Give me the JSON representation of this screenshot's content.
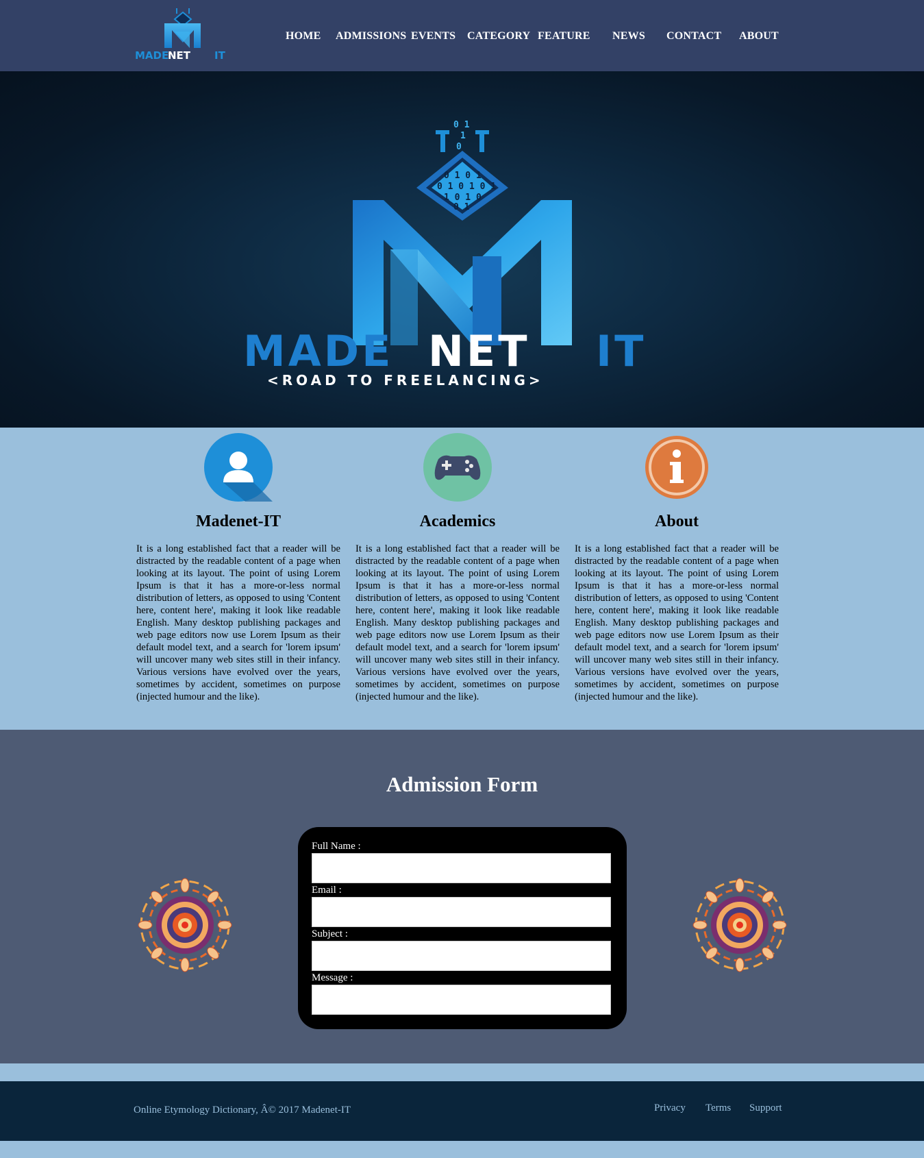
{
  "brand": {
    "logo_text": "MADENET IT",
    "logo_text_part1": "MADE",
    "logo_text_part2": "NET",
    "logo_text_part3": "IT",
    "tagline": "<ROAD TO FREELANCING>",
    "colors": {
      "nav_bg": "#334166",
      "accent_blue": "#1e8fd8",
      "light_blue": "#9abfdc"
    }
  },
  "nav": {
    "items": [
      {
        "label": "HOME"
      },
      {
        "label": "ADMISSIONS"
      },
      {
        "label": "EVENTS"
      },
      {
        "label": "CATEGORY"
      },
      {
        "label": "FEATURE"
      },
      {
        "label": "NEWS"
      },
      {
        "label": "CONTACT"
      },
      {
        "label": "ABOUT"
      }
    ]
  },
  "hero": {
    "logo_main": "MADENET IT",
    "logo_tagline": "<ROAD TO FREELANCING>",
    "binary_rows": [
      "0 1",
      "1",
      "0",
      "0 1 0 1",
      "0 1 0 1 0 1",
      "1 0 1 0",
      "0 1"
    ]
  },
  "features": [
    {
      "title": "Madenet-IT",
      "icon": "user-icon",
      "icon_color": "#1e8fd8",
      "text": "It is a long established fact that a reader will be distracted by the readable content of a page when looking at its layout. The point of using Lorem Ipsum is that it has a more-or-less normal distribution of letters, as opposed to using 'Content here, content here', making it look like readable English. Many desktop publishing packages and web page editors now use Lorem Ipsum as their default model text, and a search for 'lorem ipsum' will uncover many web sites still in their infancy. Various versions have evolved over the years, sometimes by accident, sometimes on purpose (injected humour and the like)."
    },
    {
      "title": "Academics",
      "icon": "gamepad-icon",
      "icon_color": "#6fc2a4",
      "text": "It is a long established fact that a reader will be distracted by the readable content of a page when looking at its layout. The point of using Lorem Ipsum is that it has a more-or-less normal distribution of letters, as opposed to using 'Content here, content here', making it look like readable English. Many desktop publishing packages and web page editors now use Lorem Ipsum as their default model text, and a search for 'lorem ipsum' will uncover many web sites still in their infancy. Various versions have evolved over the years, sometimes by accident, sometimes on purpose (injected humour and the like)."
    },
    {
      "title": "About",
      "icon": "info-icon",
      "icon_color": "#de7a3e",
      "text": "It is a long established fact that a reader will be distracted by the readable content of a page when looking at its layout. The point of using Lorem Ipsum is that it has a more-or-less normal distribution of letters, as opposed to using 'Content here, content here', making it look like readable English. Many desktop publishing packages and web page editors now use Lorem Ipsum as their default model text, and a search for 'lorem ipsum' will uncover many web sites still in their infancy. Various versions have evolved over the years, sometimes by accident, sometimes on purpose (injected humour and the like)."
    }
  ],
  "admission": {
    "title": "Admission Form",
    "fields": [
      {
        "label": "Full Name :",
        "value": "",
        "placeholder": ""
      },
      {
        "label": "Email :",
        "value": "",
        "placeholder": ""
      },
      {
        "label": "Subject :",
        "value": "",
        "placeholder": ""
      },
      {
        "label": "Message :",
        "value": "",
        "placeholder": ""
      }
    ],
    "decoration_icon": "mandala-icon"
  },
  "footer": {
    "copyright": "Online Etymology Dictionary, Â© 2017 Madenet-IT",
    "links": [
      {
        "label": "Privacy"
      },
      {
        "label": "Terms"
      },
      {
        "label": "Support"
      }
    ]
  }
}
